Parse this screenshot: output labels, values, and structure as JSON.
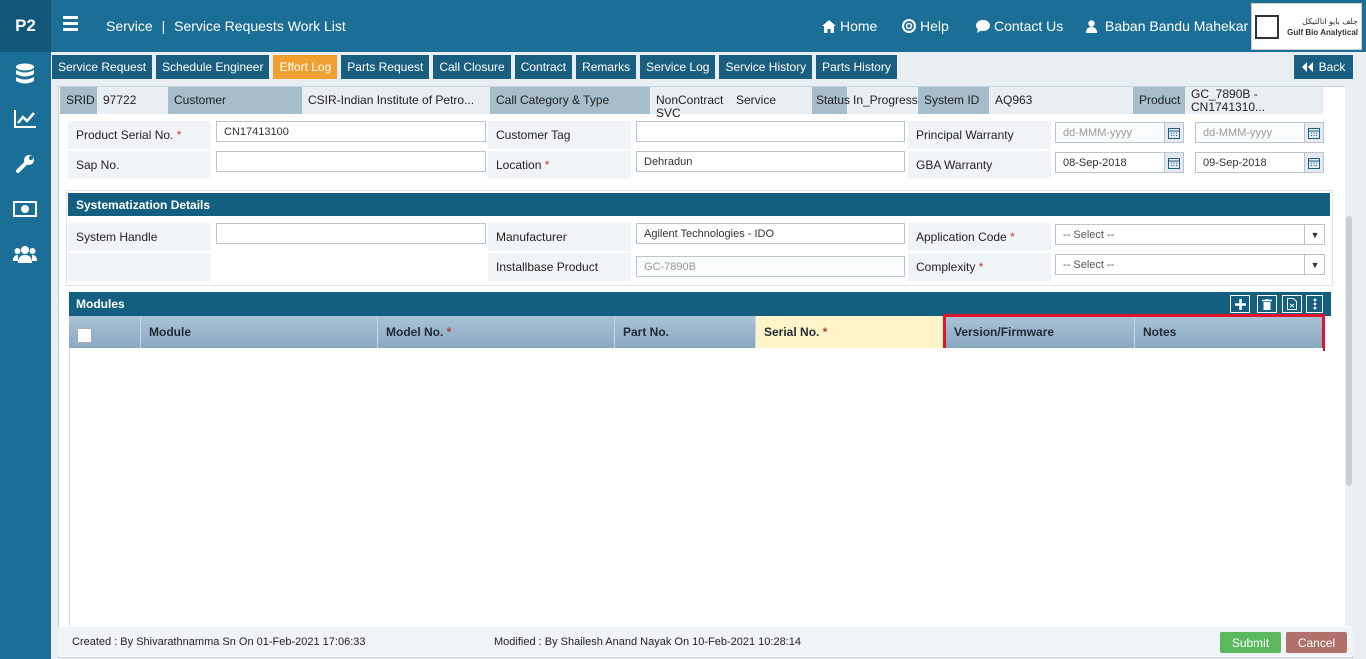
{
  "app": {
    "code": "P2"
  },
  "breadcrumb": {
    "module": "Service",
    "page": "Service Requests Work List"
  },
  "topnav": {
    "home": "Home",
    "help": "Help",
    "contact": "Contact Us",
    "user": "Baban Bandu Mahekar"
  },
  "logo": {
    "arabic": "جلف بايو انالتيكل",
    "name": "Gulf Bio Analytical"
  },
  "tabs": [
    "Service Request",
    "Schedule Engineer",
    "Effort Log",
    "Parts Request",
    "Call Closure",
    "Contract",
    "Remarks",
    "Service Log",
    "Service History",
    "Parts History"
  ],
  "active_tab": "Effort Log",
  "back_label": "Back",
  "info": {
    "srid_label": "SRID",
    "srid": "97722",
    "customer_label": "Customer",
    "customer": "CSIR-Indian Institute of Petro...",
    "category_label": "Call Category & Type",
    "category": "NonContract SVC",
    "type": "Service",
    "status_label": "Status",
    "status": "In_Progress",
    "system_label": "System ID",
    "system": "AQ963",
    "product_label": "Product",
    "product": "GC_7890B - CN1741310..."
  },
  "fields": {
    "product_serial_label": "Product Serial No.",
    "product_serial": "CN17413100",
    "customer_tag_label": "Customer Tag",
    "customer_tag": "",
    "principal_warranty_label": "Principal Warranty",
    "pw_from": "dd-MMM-yyyy",
    "pw_to": "dd-MMM-yyyy",
    "sap_label": "Sap No.",
    "sap": "",
    "location_label": "Location",
    "location": "Dehradun",
    "gba_warranty_label": "GBA Warranty",
    "gba_from": "08-Sep-2018",
    "gba_to": "09-Sep-2018"
  },
  "systematization": {
    "title": "Systematization Details",
    "system_handle_label": "System Handle",
    "system_handle": "",
    "manufacturer_label": "Manufacturer",
    "manufacturer": "Agilent Technologies - IDO",
    "application_code_label": "Application Code",
    "application_code": "-- Select --",
    "installbase_label": "Installbase Product",
    "installbase": "GC-7890B",
    "complexity_label": "Complexity",
    "complexity": "-- Select --"
  },
  "modules": {
    "title": "Modules",
    "columns": [
      "Module",
      "Model No.",
      "Part No.",
      "Serial No.",
      "Version/Firmware",
      "Notes"
    ]
  },
  "footer": {
    "created": "Created : By Shivarathnamma Sn On 01-Feb-2021 17:06:33",
    "modified": "Modified : By Shailesh Anand Nayak On 10-Feb-2021 10:28:14",
    "submit": "Submit",
    "cancel": "Cancel"
  },
  "colors": {
    "primary": "#1b6f96",
    "active_tab": "#f0a030",
    "submit": "#5cb85c",
    "cancel": "#b0716a",
    "highlight": "#e0142d"
  }
}
